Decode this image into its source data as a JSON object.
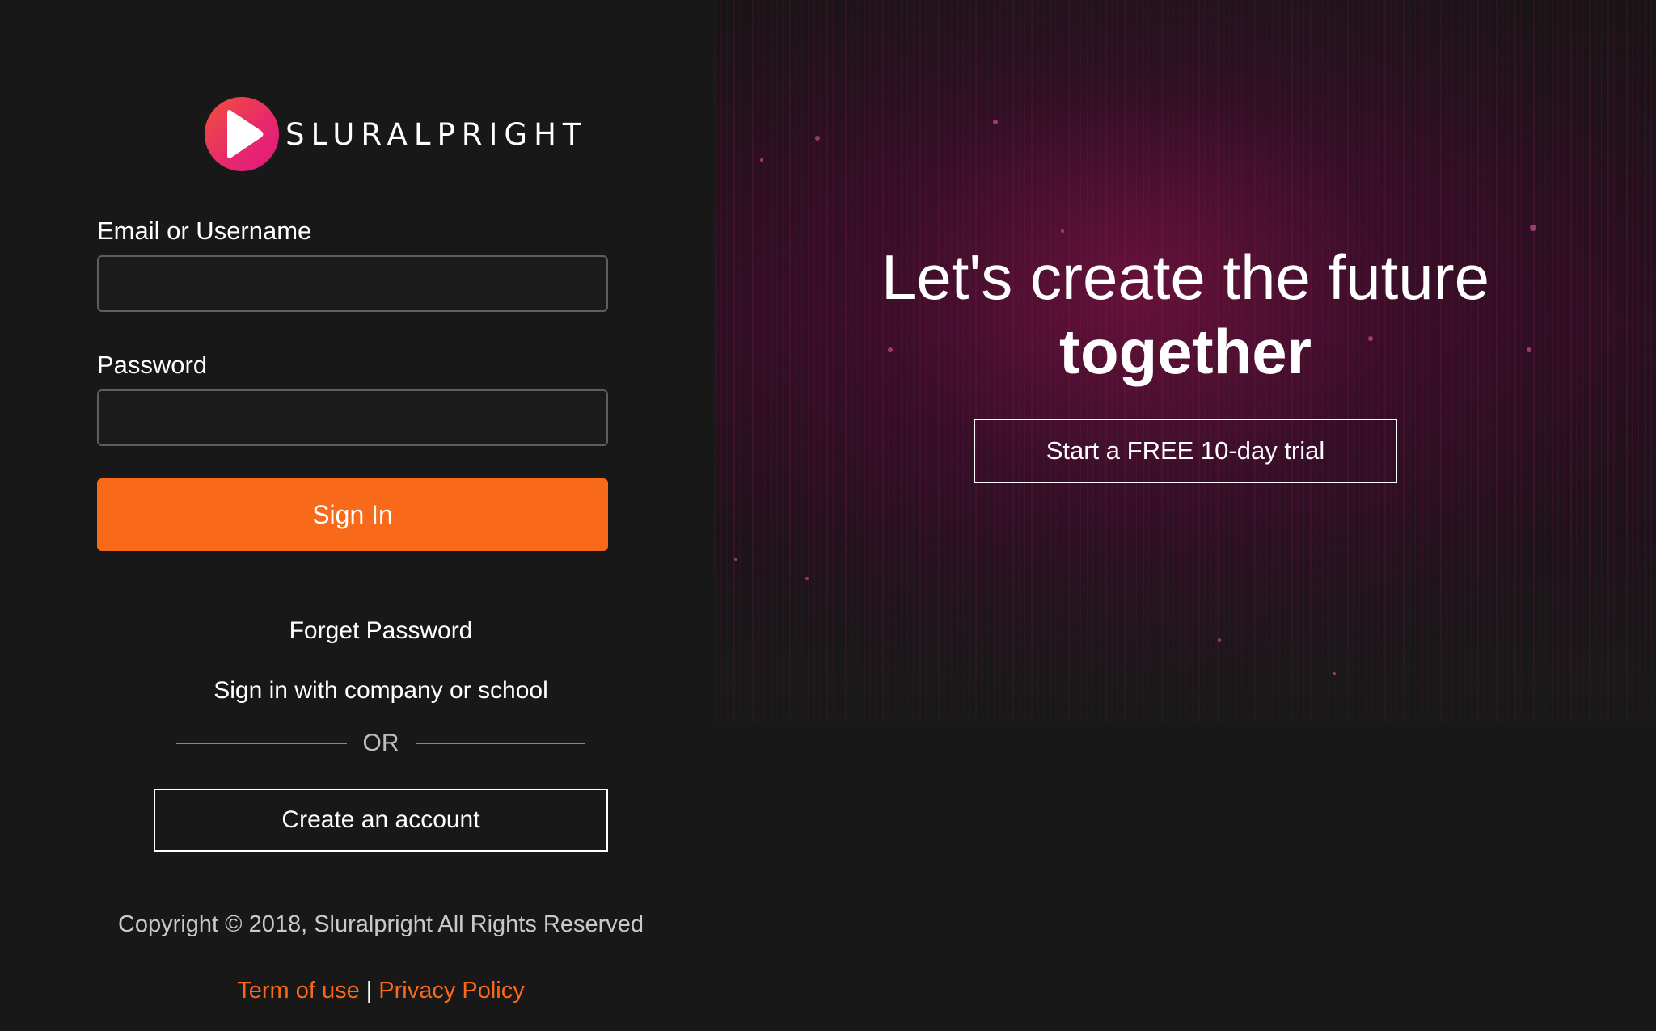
{
  "brand": {
    "name": "SLURALPRIGHT",
    "logo_icon": "play-icon",
    "logo_colors": [
      "#f0523a",
      "#e82a6a",
      "#e2177f"
    ]
  },
  "login": {
    "email_label": "Email or Username",
    "email_value": "",
    "email_placeholder": "",
    "password_label": "Password",
    "password_value": "",
    "password_placeholder": "",
    "signin_label": "Sign In",
    "forgot_label": "Forget Password",
    "sso_label": "Sign in with company or school",
    "or_label": "OR",
    "create_label": "Create an account"
  },
  "footer": {
    "copyright": "Copyright © 2018, Sluralpright All Rights Reserved",
    "terms_label": "Term of use",
    "separator": "|",
    "privacy_label": "Privacy Policy"
  },
  "hero": {
    "headline_line1": "Let's create the future",
    "headline_line2": "together",
    "trial_label": "Start a FREE 10-day trial"
  },
  "colors": {
    "accent": "#f8691a",
    "background": "#181818",
    "hero_tint": "#8c1450"
  }
}
